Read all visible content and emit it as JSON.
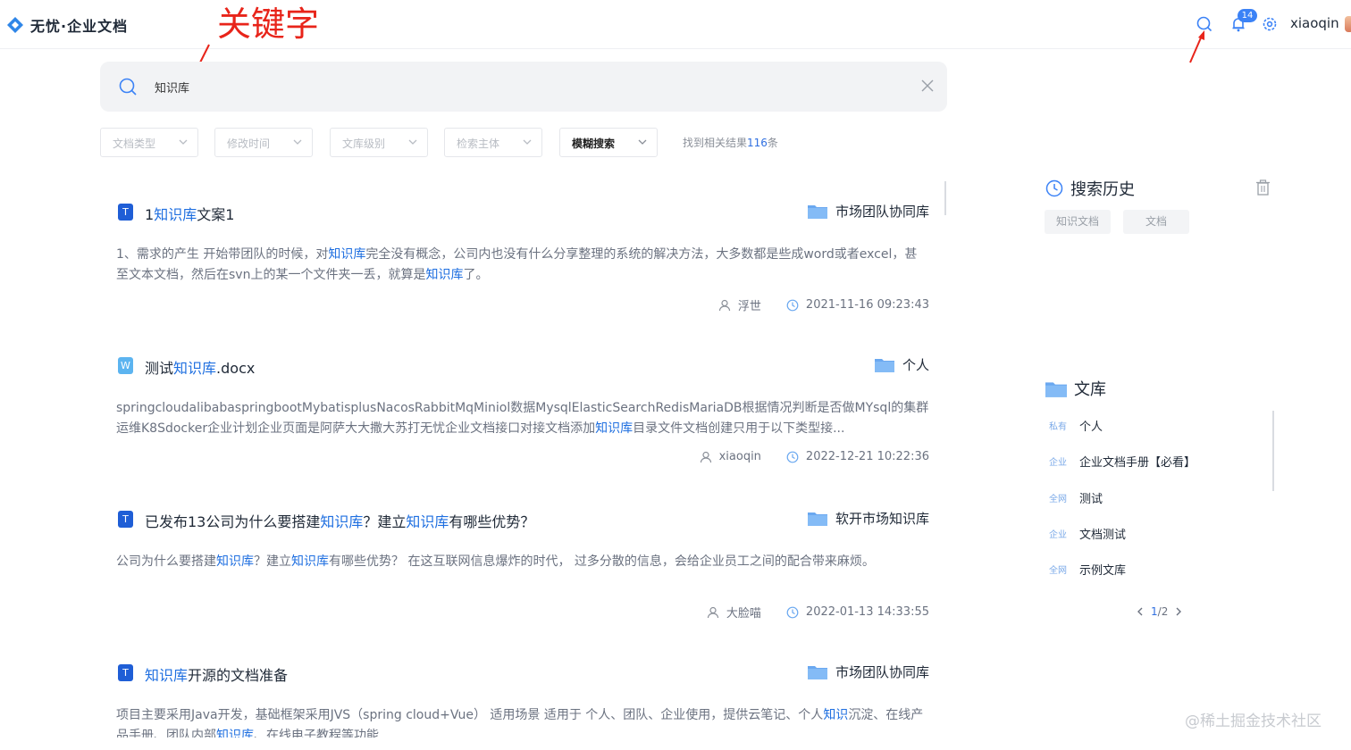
{
  "header": {
    "logo_text": "无忧·企业文档",
    "annotation_label": "关键字",
    "notification_count": "14",
    "username": "xiaoqin"
  },
  "search": {
    "query": "知识库"
  },
  "filters": [
    {
      "label": "文档类型",
      "active": false
    },
    {
      "label": "修改时间",
      "active": false
    },
    {
      "label": "文库级别",
      "active": false
    },
    {
      "label": "检索主体",
      "active": false
    },
    {
      "label": "模糊搜索",
      "active": true
    }
  ],
  "result_count": {
    "prefix": "找到相关结果",
    "count": "116",
    "suffix": "条"
  },
  "results": [
    {
      "icon": "T",
      "title_parts": [
        "1",
        "知识库",
        "文案1"
      ],
      "library": "市场团队协同库",
      "body": "1、需求的产生 开始带团队的时候，对<b>知识库</b>完全没有概念，公司内也没有什么分享整理的系统的解决方法，大多数都是些成word或者excel，甚至文本文档，然后在svn上的某一个文件夹一丢，就算是<b>知识库</b>了。",
      "author": "浮世",
      "time": "2021-11-16 09:23:43"
    },
    {
      "icon": "W",
      "title_parts": [
        "测试",
        "知识库",
        ".docx"
      ],
      "library": "个人",
      "body": "springcloudalibabaspringbootMybatisplusNacosRabbitMqMiniol数据MysqlElasticSearchRedisMariaDB根据情况判断是否做MYsql的集群运维K8Sdocker企业计划企业页面是阿萨大大撒大苏打无忧企业文档接口对接文档添加<b>知识库</b>目录文件文档创建只用于以下类型接...",
      "author": "xiaoqin",
      "time": "2022-12-21 10:22:36"
    },
    {
      "icon": "T",
      "title_parts": [
        "已发布13公司为什么要搭建",
        "知识库",
        "？建立",
        "知识库",
        "有哪些优势？"
      ],
      "library": "软开市场知识库",
      "body": "公司为什么要搭建<b>知识库</b>？建立<b>知识库</b>有哪些优势？ 在这互联网信息爆炸的时代， 过多分散的信息，会给企业员工之间的配合带来麻烦。",
      "author": "大脸喵",
      "time": "2022-01-13 14:33:55"
    },
    {
      "icon": "T",
      "title_parts": [
        "",
        "知识库",
        "开源的文档准备"
      ],
      "library": "市场团队协同库",
      "body": "项目主要采用Java开发，基础框架采用JVS（spring cloud+Vue） 适用场景 适用于 个人、团队、企业使用，提供云笔记、个人<b>知识</b>沉淀、在线产品手册、团队内部<b>知识库</b>、在线电子教程等功能",
      "author": "",
      "time": ""
    }
  ],
  "history": {
    "title": "搜索历史",
    "chips": [
      "知识文档",
      "文档"
    ]
  },
  "libraries": {
    "title": "文库",
    "items": [
      {
        "tag": "私有",
        "name": "个人"
      },
      {
        "tag": "企业",
        "name": "企业文档手册【必看】"
      },
      {
        "tag": "全网",
        "name": "测试"
      },
      {
        "tag": "企业",
        "name": "文档测试"
      },
      {
        "tag": "全网",
        "name": "示例文库"
      }
    ],
    "pager": {
      "current": "1",
      "total": "2"
    }
  },
  "watermark": "@稀土掘金技术社区",
  "colors": {
    "accent": "#1f6fe0",
    "annotation": "#e8241a"
  }
}
